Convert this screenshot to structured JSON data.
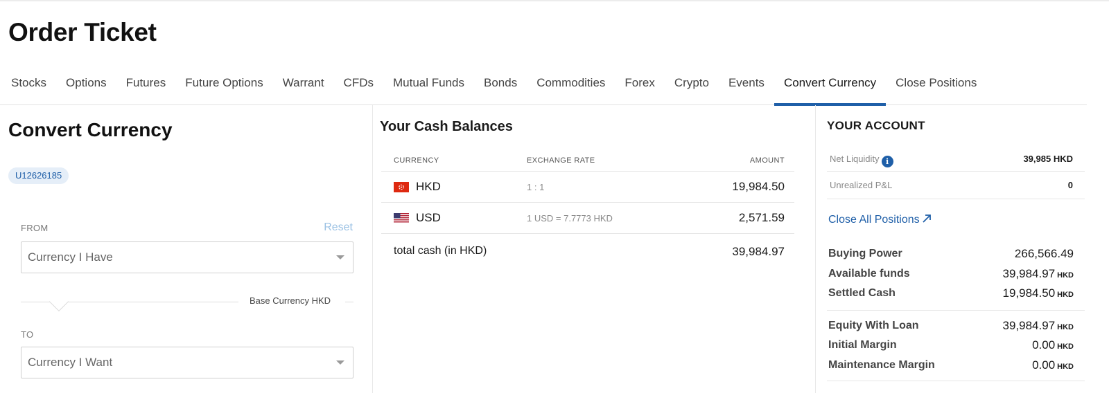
{
  "page": {
    "title": "Order Ticket"
  },
  "tabs": [
    {
      "label": "Stocks"
    },
    {
      "label": "Options"
    },
    {
      "label": "Futures"
    },
    {
      "label": "Future Options"
    },
    {
      "label": "Warrant"
    },
    {
      "label": "CFDs"
    },
    {
      "label": "Mutual Funds"
    },
    {
      "label": "Bonds"
    },
    {
      "label": "Commodities"
    },
    {
      "label": "Forex"
    },
    {
      "label": "Crypto"
    },
    {
      "label": "Events"
    },
    {
      "label": "Convert Currency"
    },
    {
      "label": "Close Positions"
    }
  ],
  "active_tab": "Convert Currency",
  "convert": {
    "title": "Convert Currency",
    "account_id": "U12626185",
    "from_label": "FROM",
    "reset_label": "Reset",
    "from_placeholder": "Currency I Have",
    "base_currency_text": "Base Currency HKD",
    "to_label": "TO",
    "to_placeholder": "Currency I Want"
  },
  "cash": {
    "title": "Your Cash Balances",
    "headers": {
      "currency": "CURRENCY",
      "rate": "EXCHANGE RATE",
      "amount": "AMOUNT"
    },
    "rows": [
      {
        "currency": "HKD",
        "flag": "hk-flag-icon",
        "rate": "1 : 1",
        "amount": "19,984.50"
      },
      {
        "currency": "USD",
        "flag": "us-flag-icon",
        "rate": "1 USD  =  7.7773 HKD",
        "amount": "2,571.59"
      }
    ],
    "total_label": "total cash (in HKD)",
    "total_amount": "39,984.97"
  },
  "account": {
    "title": "YOUR ACCOUNT",
    "net_liquidity_label": "Net Liquidity",
    "net_liquidity_value": "39,985 HKD",
    "unrealized_label": "Unrealized P&L",
    "unrealized_value": "0",
    "close_all_label": "Close All Positions",
    "info_icon_glyph": "i",
    "metrics": [
      {
        "label": "Buying Power",
        "value": "266,566.49",
        "unit": ""
      },
      {
        "label": "Available funds",
        "value": "39,984.97",
        "unit": "HKD"
      },
      {
        "label": "Settled Cash",
        "value": "19,984.50",
        "unit": "HKD"
      },
      {
        "label": "Equity With Loan",
        "value": "39,984.97",
        "unit": "HKD"
      },
      {
        "label": "Initial Margin",
        "value": "0.00",
        "unit": "HKD"
      },
      {
        "label": "Maintenance Margin",
        "value": "0.00",
        "unit": "HKD"
      }
    ]
  },
  "colors": {
    "accent": "#1f5fa8",
    "reset_link": "#9cc2e4",
    "badge_bg": "#e5eef8",
    "hk_flag_red": "#de2910"
  }
}
